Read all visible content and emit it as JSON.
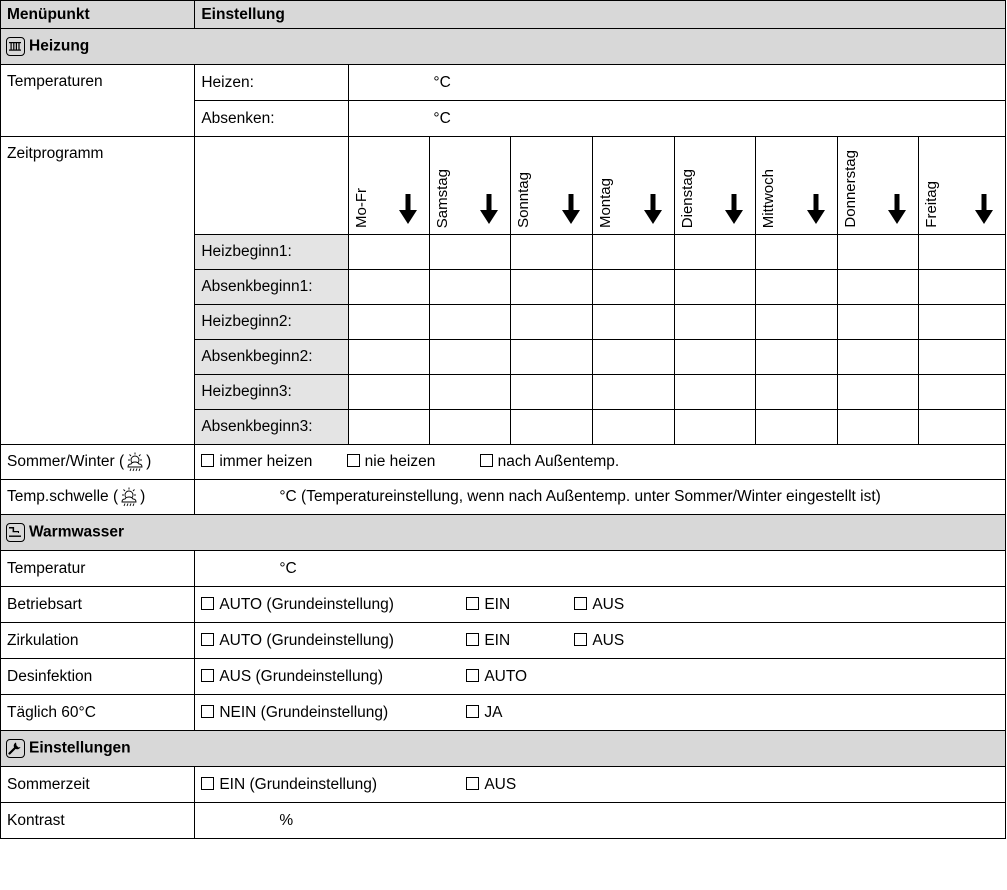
{
  "header": {
    "col1": "Menüpunkt",
    "col2": "Einstellung"
  },
  "heizung": {
    "section_title": "Heizung",
    "temperaturen_label": "Temperaturen",
    "heizen_label": "Heizen:",
    "absenken_label": "Absenken:",
    "unit_c": "°C",
    "zeitprogramm_label": "Zeitprogramm",
    "days": [
      "Mo-Fr",
      "Samstag",
      "Sonntag",
      "Montag",
      "Dienstag",
      "Mittwoch",
      "Donnerstag",
      "Freitag"
    ],
    "slots": [
      "Heizbeginn1:",
      "Absenkbeginn1:",
      "Heizbeginn2:",
      "Absenkbeginn2:",
      "Heizbeginn3:",
      "Absenkbeginn3:"
    ],
    "sommer_winter_label_pre": "Sommer/Winter (",
    "sommer_winter_options": [
      "immer heizen",
      "nie heizen",
      "nach Außentemp."
    ],
    "temp_schwelle_label_pre": "Temp.schwelle (",
    "label_close": ")",
    "temp_schwelle_text": "°C (Temperatureinstellung, wenn nach Außentemp. unter Sommer/Winter eingestellt ist)"
  },
  "warmwasser": {
    "section_title": "Warmwasser",
    "temperatur_label": "Temperatur",
    "temperatur_unit": "°C",
    "betriebsart_label": "Betriebsart",
    "betriebsart_options": [
      "AUTO (Grundeinstellung)",
      "EIN",
      "AUS"
    ],
    "zirkulation_label": "Zirkulation",
    "zirkulation_options": [
      "AUTO (Grundeinstellung)",
      "EIN",
      "AUS"
    ],
    "desinfektion_label": "Desinfektion",
    "desinfektion_options": [
      "AUS (Grundeinstellung)",
      "AUTO"
    ],
    "taeglich_label": "Täglich 60°C",
    "taeglich_options": [
      "NEIN (Grundeinstellung)",
      "JA"
    ]
  },
  "einstellungen": {
    "section_title": "Einstellungen",
    "sommerzeit_label": "Sommerzeit",
    "sommerzeit_options": [
      "EIN (Grundeinstellung)",
      "AUS"
    ],
    "kontrast_label": "Kontrast",
    "kontrast_unit": "%"
  },
  "icons": {
    "heizung": "radiator-icon",
    "warmwasser": "tap-water-icon",
    "einstellungen": "wrench-icon",
    "sun_cloud": "sun-cloud-icon",
    "day_arrow": "arrow-down-icon",
    "checkbox": "checkbox-icon"
  }
}
